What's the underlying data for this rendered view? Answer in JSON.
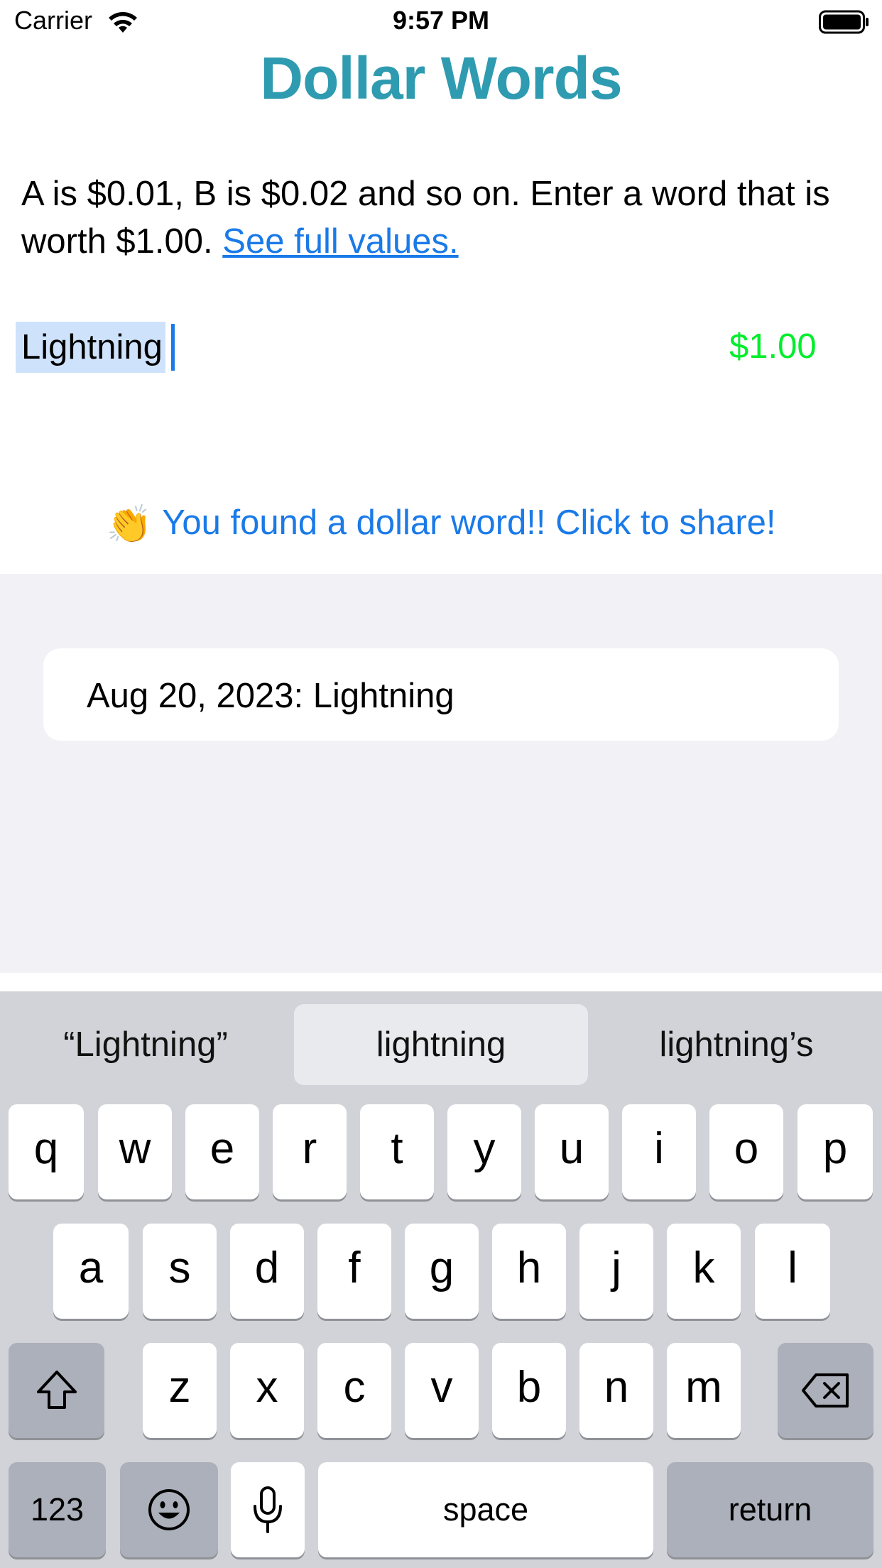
{
  "status": {
    "carrier": "Carrier",
    "time": "9:57 PM"
  },
  "title": "Dollar Words",
  "instructions": {
    "text": "A is $0.01, B is $0.02 and so on. Enter a word that is worth $1.00. ",
    "link": "See full values."
  },
  "input": {
    "value": "Lightning",
    "price": "$1.00"
  },
  "share": {
    "emoji": "👏",
    "text": "You found a dollar word!! Click to share!"
  },
  "history": [
    {
      "entry": "Aug 20, 2023: Lightning"
    }
  ],
  "keyboard": {
    "suggestions": [
      "“Lightning”",
      "lightning",
      "lightning’s"
    ],
    "row1": [
      "q",
      "w",
      "e",
      "r",
      "t",
      "y",
      "u",
      "i",
      "o",
      "p"
    ],
    "row2": [
      "a",
      "s",
      "d",
      "f",
      "g",
      "h",
      "j",
      "k",
      "l"
    ],
    "row3": [
      "z",
      "x",
      "c",
      "v",
      "b",
      "n",
      "m"
    ],
    "numbers_label": "123",
    "space_label": "space",
    "return_label": "return"
  },
  "colors": {
    "title": "#2e9bb0",
    "link": "#1a7ae8",
    "price": "#00ee2c",
    "selection": "#cfe2fb",
    "history_background": "#f1f1f6",
    "keyboard_background": "#d1d3d9"
  }
}
